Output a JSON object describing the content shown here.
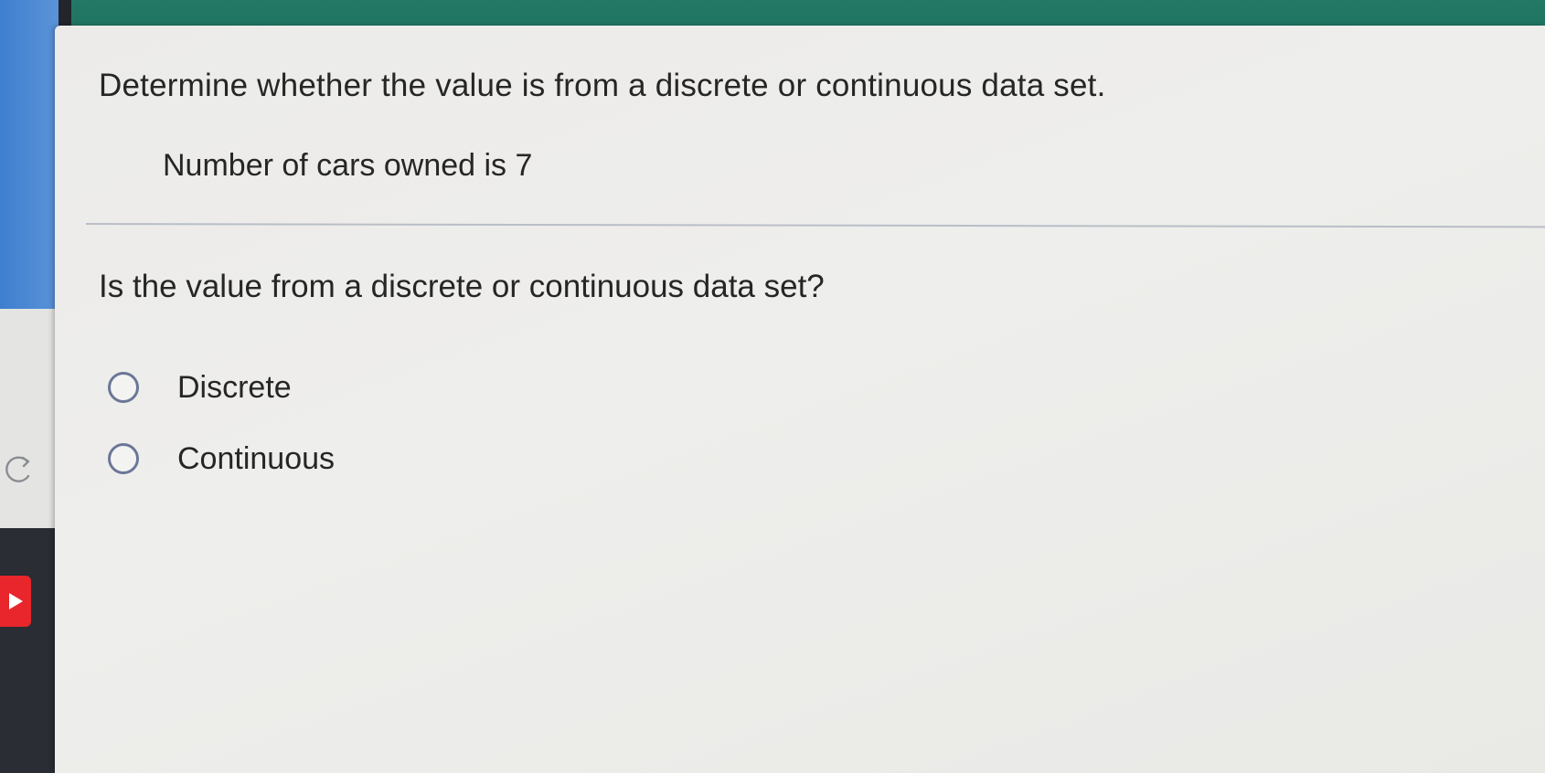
{
  "question_panel": {
    "instruction": "Determine whether the value is from a discrete or continuous data set.",
    "given_value": "Number of cars owned is 7",
    "question": "Is the value from a discrete or continuous data set?",
    "options": [
      {
        "label": "Discrete",
        "selected": false
      },
      {
        "label": "Continuous",
        "selected": false
      }
    ]
  },
  "sidebar": {
    "icons": [
      "refresh-icon",
      "play-icon"
    ]
  },
  "colors": {
    "header": "#237866",
    "sidebar_blue": "#4a86d4",
    "play_button": "#e8262b",
    "radio_border": "#6b7796",
    "text": "#262626"
  }
}
